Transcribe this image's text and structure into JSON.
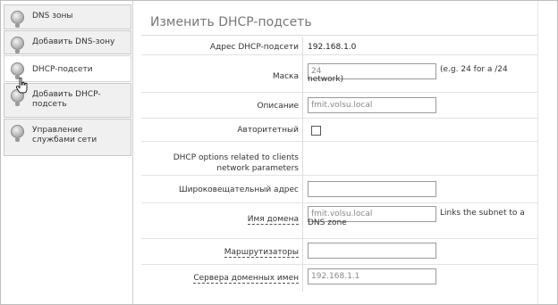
{
  "sidebar": {
    "items": [
      {
        "label": "DNS зоны"
      },
      {
        "label": "Добавить DNS-зону"
      },
      {
        "label": "DHCP-подсети"
      },
      {
        "label": "Добавить DHCP-подсеть"
      },
      {
        "label": "Управление службами сети"
      }
    ]
  },
  "main": {
    "title": "Изменить DHCP-подсеть",
    "form": {
      "address_label": "Адрес DHCP-подсети",
      "address_value": "192.168.1.0",
      "mask_label": "Маска",
      "mask_value": "24",
      "mask_hint": "(e.g. 24 for a /24 network)",
      "description_label": "Описание",
      "description_value": "fmit.volsu.local",
      "authoritative_label": "Авторитетный",
      "dhcp_options_heading": "DHCP options related to clients network parameters",
      "broadcast_label": "Широковещательный адрес",
      "broadcast_value": "",
      "domain_label": "Имя домена",
      "domain_value": "fmit.volsu.local",
      "domain_hint": "Links the subnet to a DNS zone",
      "routers_label": "Маршрутизаторы",
      "routers_value": "",
      "dns_servers_label": "Сервера доменных имен",
      "dns_servers_value": "192.168.1.1"
    }
  }
}
